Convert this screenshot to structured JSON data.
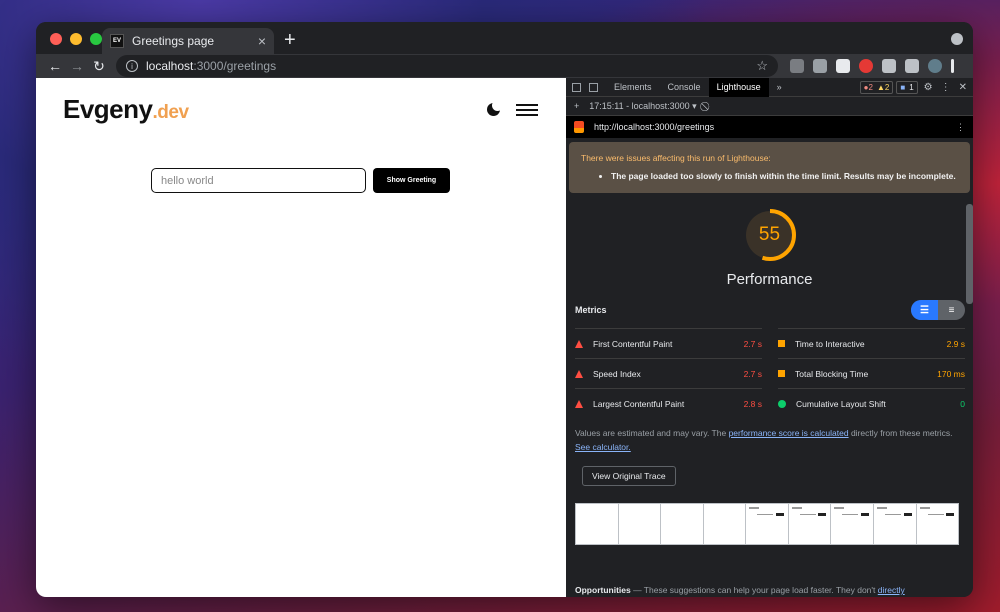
{
  "browser": {
    "tab_title": "Greetings page",
    "favicon_text": "EV",
    "url_host": "localhost",
    "url_path": ":3000/greetings",
    "new_tab": "+",
    "tab_close": "×"
  },
  "page": {
    "logo_main": "Evgeny",
    "logo_suffix": ".dev",
    "input_value": "hello world",
    "button_label": "Show Greeting"
  },
  "devtools": {
    "tabs": [
      "Elements",
      "Console",
      "Lighthouse"
    ],
    "active_tab": "Lighthouse",
    "more_tabs": "»",
    "badges": {
      "errors": "2",
      "warnings": "2",
      "info": "1"
    },
    "session_label": "17:15:11 - localhost:3000",
    "report_url": "http://localhost:3000/greetings",
    "warning_head": "There were issues affecting this run of Lighthouse:",
    "warning_item": "The page loaded too slowly to finish within the time limit. Results may be incomplete.",
    "score": "55",
    "score_fraction": 0.55,
    "category_title": "Performance",
    "metrics_title": "Metrics",
    "metrics": [
      {
        "label": "First Contentful Paint",
        "value": "2.7 s",
        "status": "fail"
      },
      {
        "label": "Time to Interactive",
        "value": "2.9 s",
        "status": "average"
      },
      {
        "label": "Speed Index",
        "value": "2.7 s",
        "status": "fail"
      },
      {
        "label": "Total Blocking Time",
        "value": "170 ms",
        "status": "average"
      },
      {
        "label": "Largest Contentful Paint",
        "value": "2.8 s",
        "status": "fail"
      },
      {
        "label": "Cumulative Layout Shift",
        "value": "0",
        "status": "pass"
      }
    ],
    "note_prefix": "Values are estimated and may vary. The ",
    "note_link": "performance score is calculated",
    "note_mid": " directly from these metrics. ",
    "note_link2": "See calculator.",
    "trace_button": "View Original Trace",
    "opps_title": "Opportunities",
    "opps_text": " — These suggestions can help your page load faster. They don't ",
    "opps_link": "directly"
  },
  "colors": {
    "fail": "#ff4e42",
    "average": "#ffa400",
    "pass": "#0cce6b",
    "accent": "#f0a050"
  }
}
